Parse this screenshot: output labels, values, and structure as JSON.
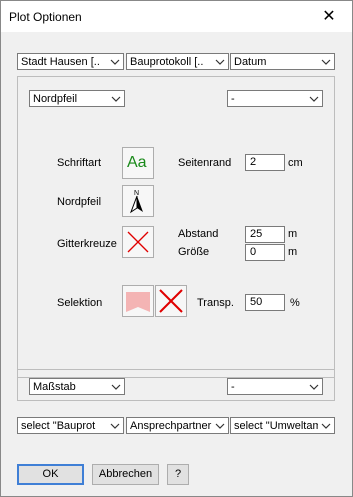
{
  "window": {
    "title": "Plot Optionen",
    "close_glyph": "✕"
  },
  "top_selects": [
    {
      "value": "Stadt Hausen [.."
    },
    {
      "value": "Bauprotokoll [.."
    },
    {
      "value": "Datum"
    }
  ],
  "upper_panel": {
    "north_arrow_select": "Nordpfeil",
    "right_select": "-",
    "font_label": "Schriftart",
    "font_button_text": "Aa",
    "margin_label": "Seitenrand",
    "margin_value": "2",
    "margin_unit": "cm",
    "north_arrow_label": "Nordpfeil",
    "grid_label": "Gitterkreuze",
    "distance_label": "Abstand",
    "distance_value": "25",
    "distance_unit": "m",
    "size_label": "Größe",
    "size_value": "0",
    "size_unit": "m",
    "selection_label": "Selektion",
    "transparency_label": "Transp.",
    "transparency_value": "50",
    "transparency_unit": "%",
    "selection_fill_color": "#f4b4b4",
    "cross_color": "#e00000"
  },
  "lower_panel": {
    "scale_select": "Maßstab",
    "right_select": "-"
  },
  "bottom_selects": [
    {
      "value": "select \"Bauprot"
    },
    {
      "value": "Ansprechpartner"
    },
    {
      "value": "select \"Umweltam"
    }
  ],
  "buttons": {
    "ok": "OK",
    "cancel": "Abbrechen",
    "help": "?"
  }
}
